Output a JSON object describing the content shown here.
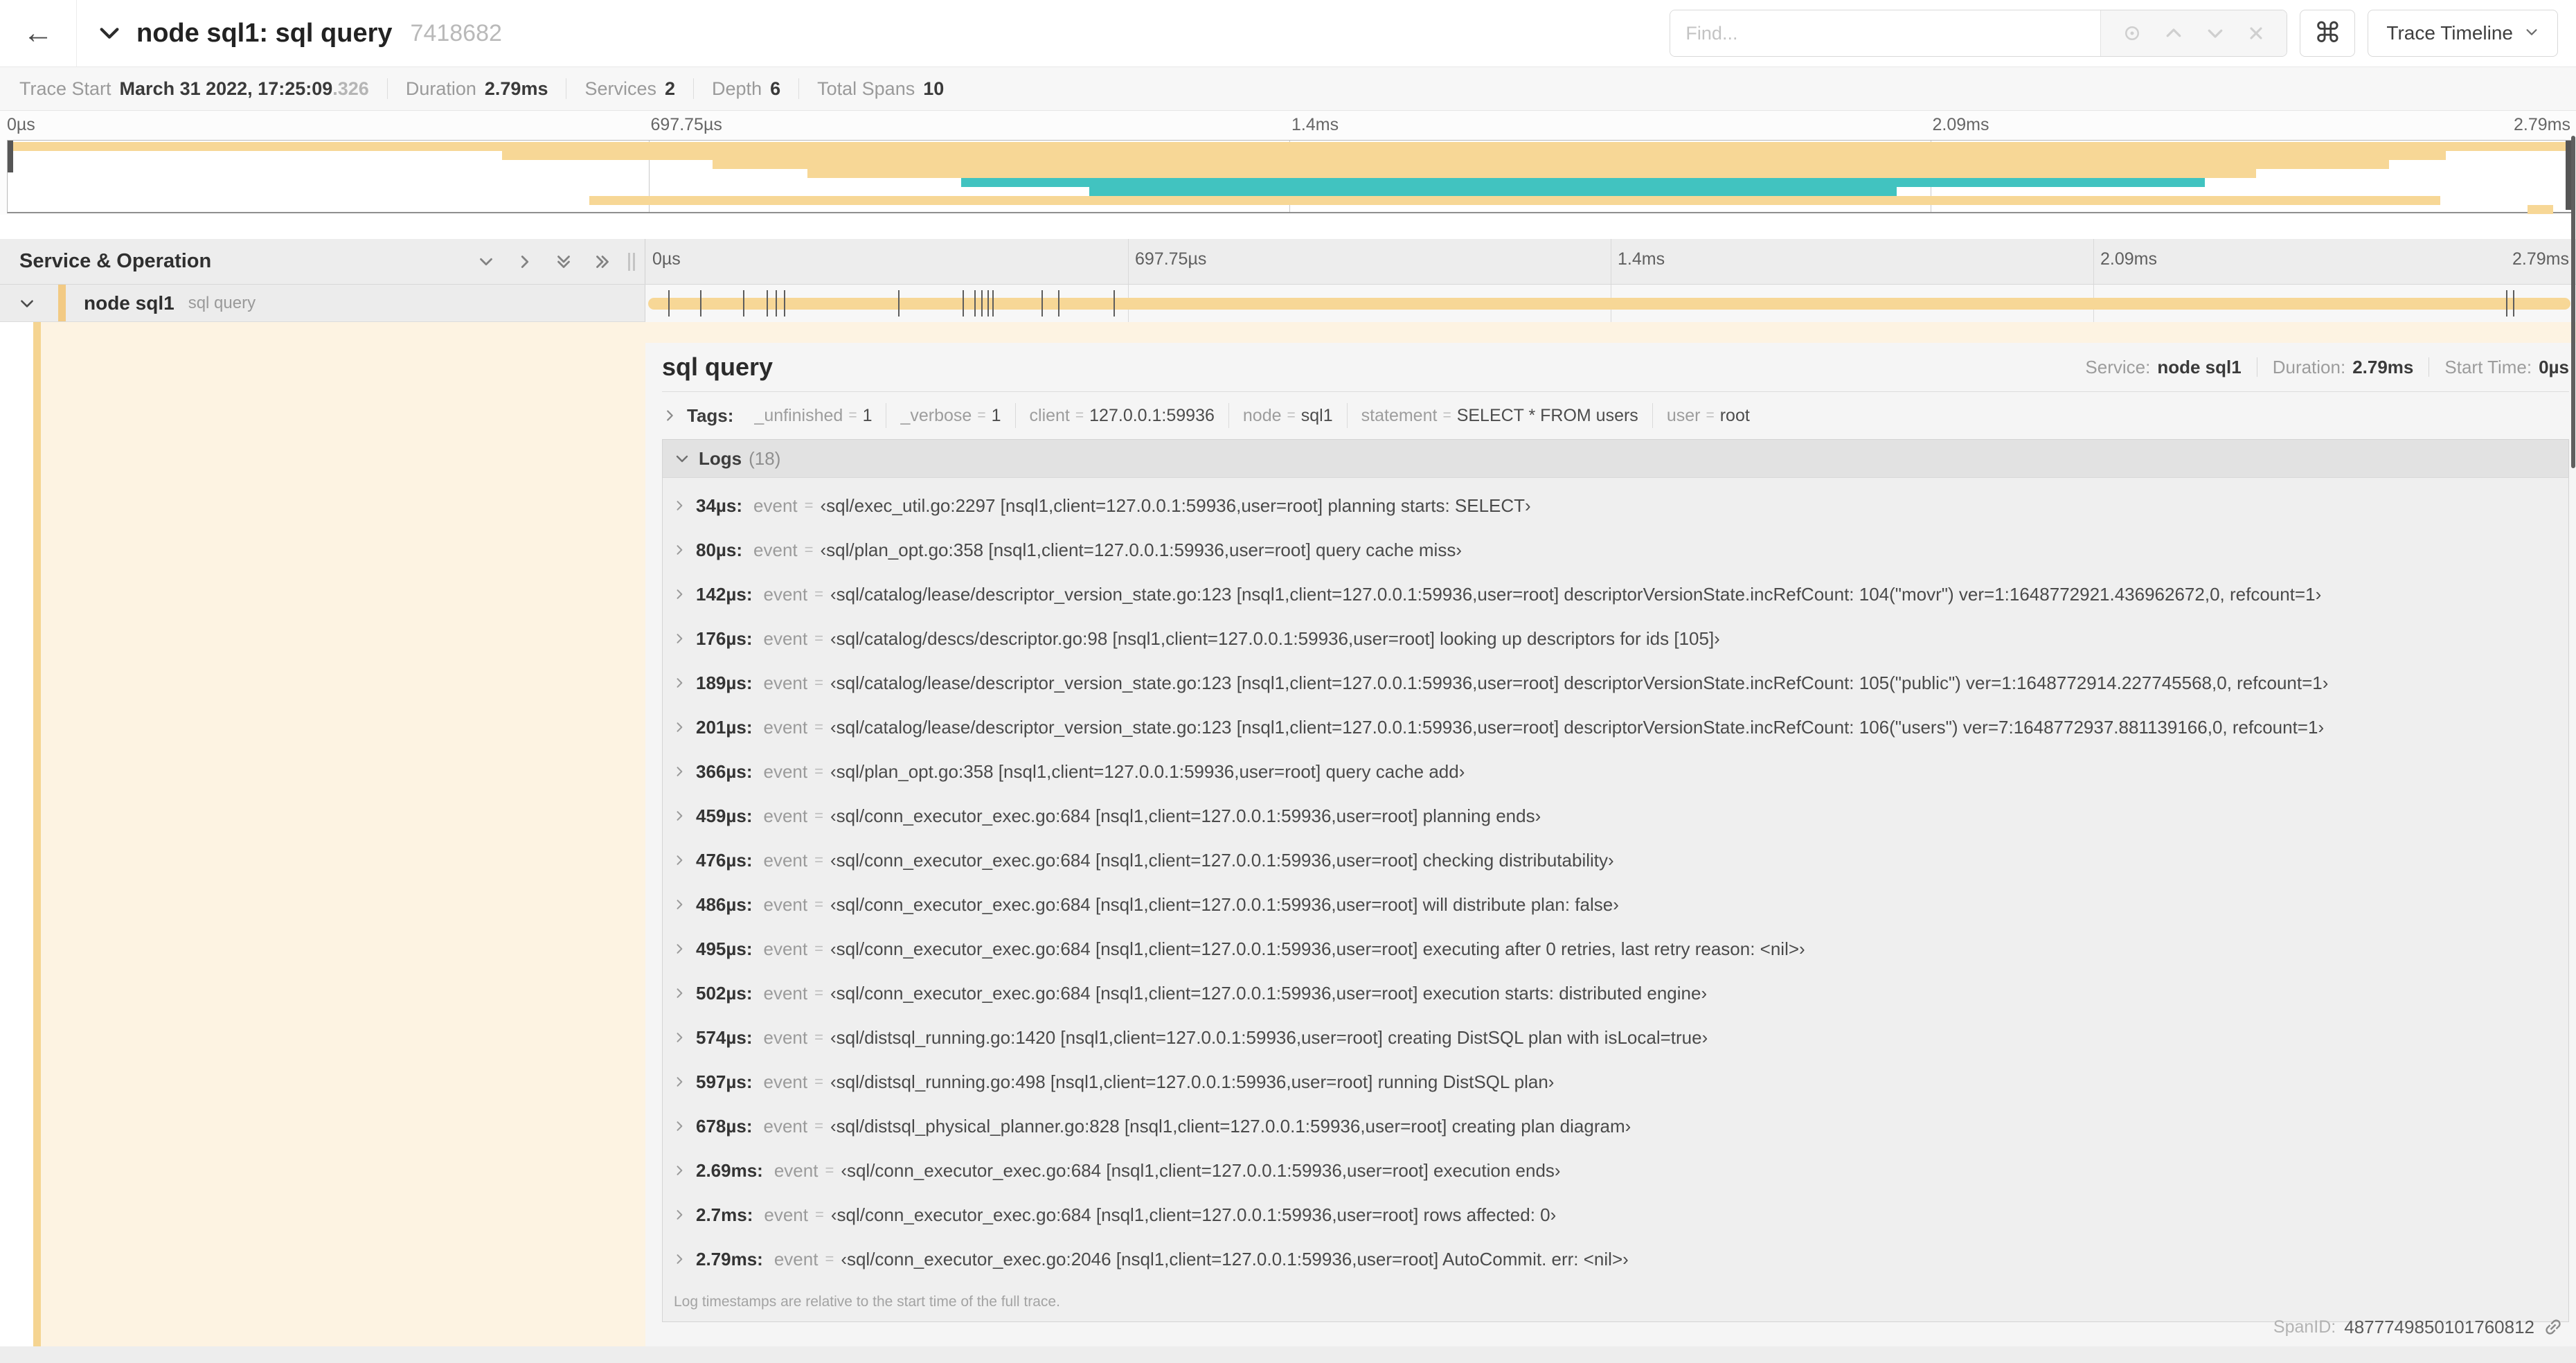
{
  "header": {
    "back_icon": "←",
    "title": "node sql1: sql query",
    "trace_id": "7418682",
    "find_placeholder": "Find...",
    "shortcut_key": "⌘",
    "view_selector_label": "Trace Timeline"
  },
  "summary": {
    "items": [
      {
        "label": "Trace Start",
        "value": "March 31 2022, 17:25:09",
        "suffix": ".326"
      },
      {
        "label": "Duration",
        "value": "2.79ms"
      },
      {
        "label": "Services",
        "value": "2"
      },
      {
        "label": "Depth",
        "value": "6"
      },
      {
        "label": "Total Spans",
        "value": "10"
      }
    ]
  },
  "timeline": {
    "ticks": [
      "0µs",
      "697.75µs",
      "1.4ms",
      "2.09ms",
      "2.79ms"
    ],
    "tick_fractions": [
      0,
      0.25,
      0.5,
      0.75,
      1
    ],
    "colors": {
      "tan": "#f7d796",
      "teal": "#41c3c0",
      "cream": "#fdf3e2"
    },
    "minimap_bars": [
      {
        "start": 0,
        "end": 100,
        "color": "tan"
      },
      {
        "start": 19.3,
        "end": 95.1,
        "color": "tan"
      },
      {
        "start": 27.5,
        "end": 92.9,
        "color": "tan"
      },
      {
        "start": 31.2,
        "end": 87.7,
        "color": "tan"
      },
      {
        "start": 37.2,
        "end": 85.7,
        "color": "teal"
      },
      {
        "start": 42.2,
        "end": 73.7,
        "color": "teal"
      },
      {
        "start": 22.7,
        "end": 94.9,
        "color": "tan"
      },
      {
        "start": 98.3,
        "end": 99.3,
        "color": "tan"
      }
    ]
  },
  "span_table": {
    "header_label": "Service & Operation",
    "row": {
      "service": "node sql1",
      "operation": "sql query"
    },
    "log_marker_percents": [
      1.22,
      2.87,
      5.09,
      6.31,
      6.77,
      7.2,
      13.12,
      16.45,
      17.06,
      17.42,
      17.74,
      18.0,
      20.57,
      21.4,
      24.3,
      96.42,
      96.77,
      99.8
    ]
  },
  "detail": {
    "title": "sql query",
    "meta": [
      {
        "label": "Service:",
        "value": "node sql1"
      },
      {
        "label": "Duration:",
        "value": "2.79ms"
      },
      {
        "label": "Start Time:",
        "value": "0µs"
      }
    ],
    "tags_label": "Tags:",
    "eq": "=",
    "tags": [
      {
        "key": "_unfinished",
        "value": "1"
      },
      {
        "key": "_verbose",
        "value": "1"
      },
      {
        "key": "client",
        "value": "127.0.0.1:59936"
      },
      {
        "key": "node",
        "value": "sql1"
      },
      {
        "key": "statement",
        "value": "SELECT * FROM users"
      },
      {
        "key": "user",
        "value": "root"
      }
    ],
    "logs_label": "Logs",
    "logs_count": "(18)",
    "logs": [
      {
        "t": "34µs:",
        "field": "event",
        "value": "‹sql/exec_util.go:2297 [nsql1,client=127.0.0.1:59936,user=root] planning starts: SELECT›"
      },
      {
        "t": "80µs:",
        "field": "event",
        "value": "‹sql/plan_opt.go:358 [nsql1,client=127.0.0.1:59936,user=root] query cache miss›"
      },
      {
        "t": "142µs:",
        "field": "event",
        "value": "‹sql/catalog/lease/descriptor_version_state.go:123 [nsql1,client=127.0.0.1:59936,user=root] descriptorVersionState.incRefCount: 104(\"movr\") ver=1:1648772921.436962672,0, refcount=1›"
      },
      {
        "t": "176µs:",
        "field": "event",
        "value": "‹sql/catalog/descs/descriptor.go:98 [nsql1,client=127.0.0.1:59936,user=root] looking up descriptors for ids [105]›"
      },
      {
        "t": "189µs:",
        "field": "event",
        "value": "‹sql/catalog/lease/descriptor_version_state.go:123 [nsql1,client=127.0.0.1:59936,user=root] descriptorVersionState.incRefCount: 105(\"public\") ver=1:1648772914.227745568,0, refcount=1›"
      },
      {
        "t": "201µs:",
        "field": "event",
        "value": "‹sql/catalog/lease/descriptor_version_state.go:123 [nsql1,client=127.0.0.1:59936,user=root] descriptorVersionState.incRefCount: 106(\"users\") ver=7:1648772937.881139166,0, refcount=1›"
      },
      {
        "t": "366µs:",
        "field": "event",
        "value": "‹sql/plan_opt.go:358 [nsql1,client=127.0.0.1:59936,user=root] query cache add›"
      },
      {
        "t": "459µs:",
        "field": "event",
        "value": "‹sql/conn_executor_exec.go:684 [nsql1,client=127.0.0.1:59936,user=root] planning ends›"
      },
      {
        "t": "476µs:",
        "field": "event",
        "value": "‹sql/conn_executor_exec.go:684 [nsql1,client=127.0.0.1:59936,user=root] checking distributability›"
      },
      {
        "t": "486µs:",
        "field": "event",
        "value": "‹sql/conn_executor_exec.go:684 [nsql1,client=127.0.0.1:59936,user=root] will distribute plan: false›"
      },
      {
        "t": "495µs:",
        "field": "event",
        "value": "‹sql/conn_executor_exec.go:684 [nsql1,client=127.0.0.1:59936,user=root] executing after 0 retries, last retry reason: <nil>›"
      },
      {
        "t": "502µs:",
        "field": "event",
        "value": "‹sql/conn_executor_exec.go:684 [nsql1,client=127.0.0.1:59936,user=root] execution starts: distributed engine›"
      },
      {
        "t": "574µs:",
        "field": "event",
        "value": "‹sql/distsql_running.go:1420 [nsql1,client=127.0.0.1:59936,user=root] creating DistSQL plan with isLocal=true›"
      },
      {
        "t": "597µs:",
        "field": "event",
        "value": "‹sql/distsql_running.go:498 [nsql1,client=127.0.0.1:59936,user=root] running DistSQL plan›"
      },
      {
        "t": "678µs:",
        "field": "event",
        "value": "‹sql/distsql_physical_planner.go:828 [nsql1,client=127.0.0.1:59936,user=root] creating plan diagram›"
      },
      {
        "t": "2.69ms:",
        "field": "event",
        "value": "‹sql/conn_executor_exec.go:684 [nsql1,client=127.0.0.1:59936,user=root] execution ends›"
      },
      {
        "t": "2.7ms:",
        "field": "event",
        "value": "‹sql/conn_executor_exec.go:684 [nsql1,client=127.0.0.1:59936,user=root] rows affected: 0›"
      },
      {
        "t": "2.79ms:",
        "field": "event",
        "value": "‹sql/conn_executor_exec.go:2046 [nsql1,client=127.0.0.1:59936,user=root] AutoCommit. err: <nil>›"
      }
    ],
    "logs_note": "Log timestamps are relative to the start time of the full trace.",
    "span_id_label": "SpanID:",
    "span_id": "4877749850101760812"
  }
}
